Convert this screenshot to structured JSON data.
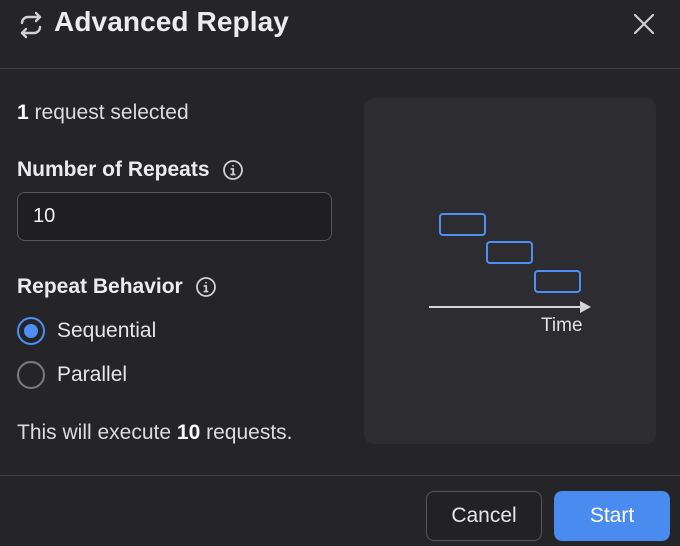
{
  "dialog": {
    "title": "Advanced Replay",
    "title_icon": "replay-arrows-icon",
    "close_icon": "close-icon"
  },
  "selection": {
    "count": "1",
    "suffix": "request selected"
  },
  "repeats": {
    "label": "Number of Repeats",
    "value": "10",
    "info_icon": "info-icon"
  },
  "behavior": {
    "label": "Repeat Behavior",
    "info_icon": "info-icon",
    "options": [
      {
        "label": "Sequential",
        "selected": true
      },
      {
        "label": "Parallel",
        "selected": false
      }
    ]
  },
  "summary": {
    "prefix": "This will execute",
    "count": "10",
    "suffix": "requests."
  },
  "preview": {
    "axis_label": "Time"
  },
  "buttons": {
    "cancel": "Cancel",
    "start": "Start"
  },
  "colors": {
    "accent": "#4a8bf0",
    "background": "#252528"
  }
}
